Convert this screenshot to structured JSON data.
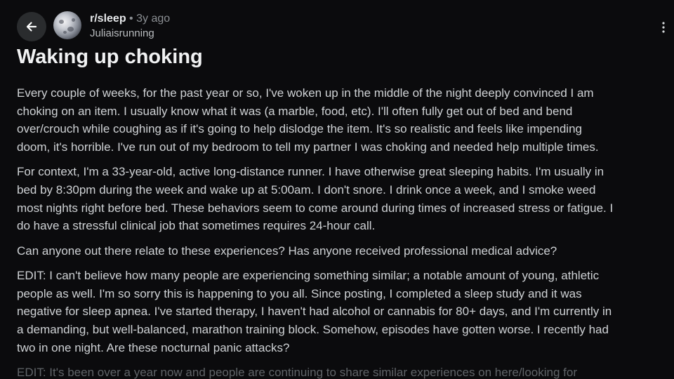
{
  "post": {
    "subreddit": "r/sleep",
    "separator": "•",
    "age": "3y ago",
    "author": "Juliaisrunning",
    "title": "Waking up choking",
    "paragraphs": [
      {
        "lines": [
          "Every couple of weeks, for the past year or so, I've woken up in the middle of the night deeply convinced I am",
          "choking on an item. I usually know what it was (a marble, food, etc). I'll often fully get out of bed and bend",
          "over/crouch while coughing as if it's going to help dislodge the item. It's so realistic and feels like impending",
          "doom, it's horrible. I've run out of my bedroom to tell my partner I was choking and needed help multiple times."
        ]
      },
      {
        "lines": [
          "For context, I'm a 33-year-old, active long-distance runner. I have otherwise great sleeping habits. I'm usually in",
          "bed by 8:30pm during the week and wake up at 5:00am. I don't snore. I drink once a week, and I smoke weed",
          "most nights right before bed. These behaviors seem to come around during times of increased stress or fatigue. I",
          "do have a stressful clinical job that sometimes requires 24-hour call."
        ]
      },
      {
        "lines": [
          "Can anyone out there relate to these experiences? Has anyone received professional medical advice?"
        ]
      },
      {
        "lines": [
          "EDIT: I can't believe how many people are experiencing something similar; a notable amount of young, athletic",
          "people as well. I'm so sorry this is happening to you all. Since posting, I completed a sleep study and it was",
          "negative for sleep apnea. I've started therapy, I haven't had alcohol or cannabis for 80+ days, and I'm currently in",
          "a demanding, but well-balanced, marathon training block. Somehow, episodes have gotten worse. I recently had",
          "two in one night. Are these nocturnal panic attacks?"
        ]
      },
      {
        "lines": [
          "EDIT: It's been over a year now and people are continuing to share similar experiences on here/looking for"
        ]
      }
    ]
  },
  "icons": {
    "back": "arrow-left-icon",
    "avatar": "moon-avatar",
    "more": "more-vertical-icon"
  },
  "colors": {
    "background": "#0b0b0d",
    "title": "#f1f2f3",
    "body_text": "#cfd2d5",
    "meta_text": "#8b8f93",
    "faded_text": "#5f6367",
    "button_bg": "#2a2c2e"
  }
}
